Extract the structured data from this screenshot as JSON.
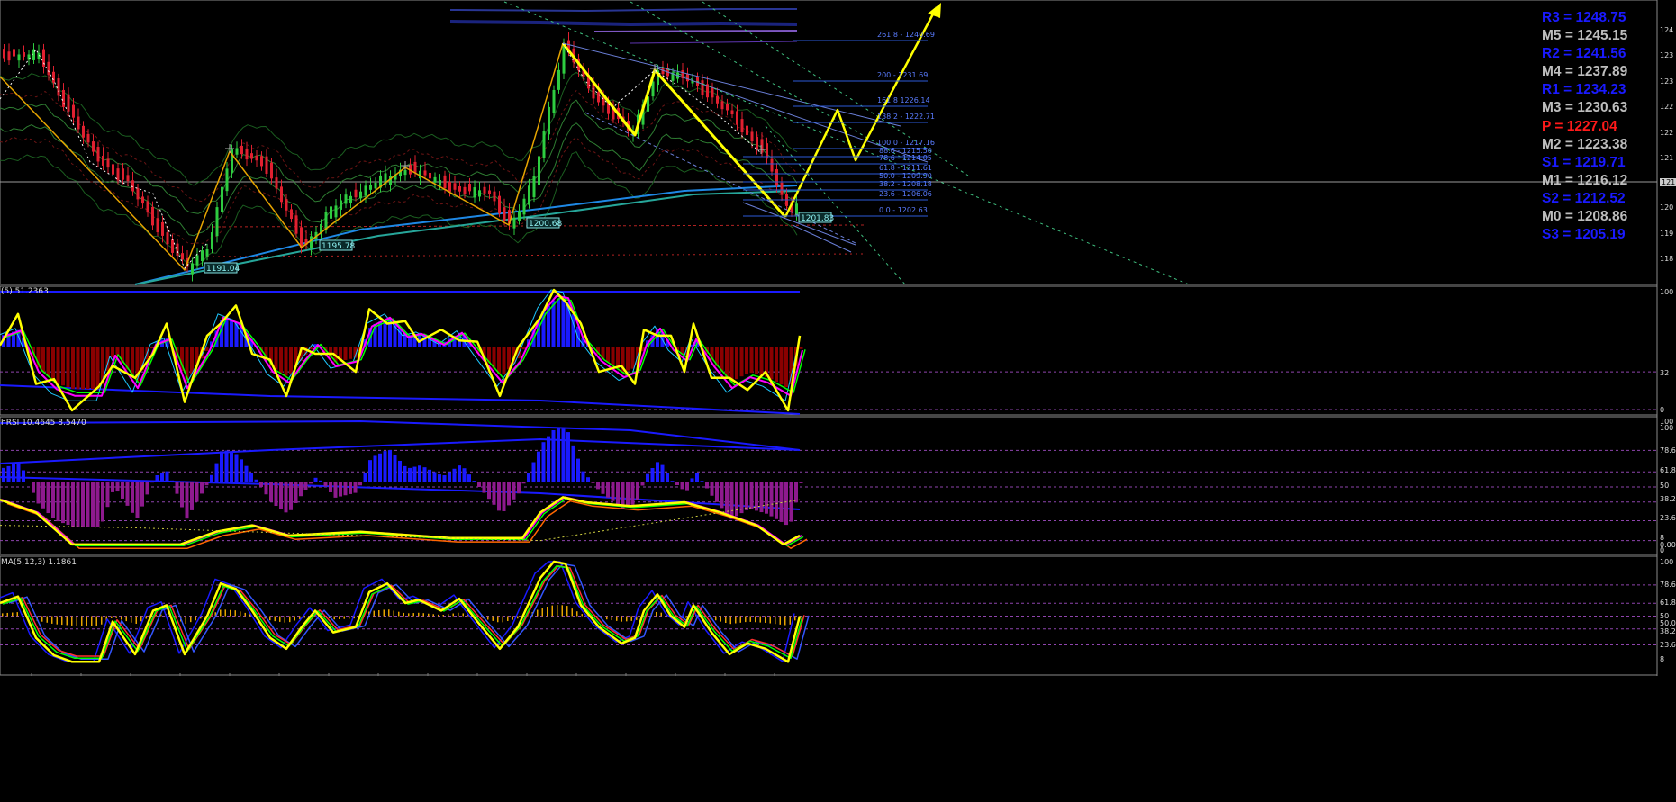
{
  "colors": {
    "background": "#000000",
    "candle_up": "#2ecc40",
    "candle_down": "#e02030",
    "zigzag": "#ffcc00",
    "projection": "#ffff00",
    "histogram_up": "#1a1aff",
    "histogram_down_1": "#8b0000",
    "histogram_down_2": "#8e1a8e",
    "fib_line": "#2b5ad8",
    "pivot_blue": "#1a1aff",
    "pivot_gray": "#bdbdbd",
    "pivot_red": "#ff1a1a"
  },
  "panes": [
    {
      "id": "price",
      "label": ""
    },
    {
      "id": "osc1",
      "label": "(5) 51.2363"
    },
    {
      "id": "osc2",
      "label": "hRSI 10.4645 8.5470"
    },
    {
      "id": "osc3",
      "label": "MA(5,12,3) 1.1861"
    }
  ],
  "price_axis_labels": [
    "124",
    "123",
    "123",
    "122",
    "122",
    "121",
    "121",
    "120",
    "119",
    "118"
  ],
  "current_price_tag": "121",
  "osc1_axis_labels": [
    "100",
    "32",
    "0"
  ],
  "osc2_axis_labels": [
    "100",
    "100",
    "78.6",
    "61.8",
    "50",
    "38.2",
    "23.6",
    "8",
    "0.00",
    "0"
  ],
  "osc3_axis_labels": [
    "100",
    "78.6",
    "61.8",
    "50",
    "50.00",
    "38.2",
    "23.6",
    "8"
  ],
  "pivots": [
    {
      "name": "R3",
      "value": "= 1248.75",
      "text": "R3 = 1248.75",
      "style": "blue"
    },
    {
      "name": "M5",
      "value": "= 1245.15",
      "text": "M5 = 1245.15",
      "style": "gray"
    },
    {
      "name": "R2",
      "value": "= 1241.56",
      "text": "R2 = 1241.56",
      "style": "blue"
    },
    {
      "name": "M4",
      "value": "= 1237.89",
      "text": "M4 = 1237.89",
      "style": "gray"
    },
    {
      "name": "R1",
      "value": "= 1234.23",
      "text": "R1 = 1234.23",
      "style": "blue"
    },
    {
      "name": "M3",
      "value": "= 1230.63",
      "text": "M3 = 1230.63",
      "style": "gray"
    },
    {
      "name": "P",
      "value": "= 1227.04",
      "text": "P  = 1227.04",
      "style": "red"
    },
    {
      "name": "M2",
      "value": "= 1223.38",
      "text": "M2 = 1223.38",
      "style": "gray"
    },
    {
      "name": "S1",
      "value": "= 1219.71",
      "text": "S1 = 1219.71",
      "style": "blue"
    },
    {
      "name": "M1",
      "value": "= 1216.12",
      "text": "M1 = 1216.12",
      "style": "gray"
    },
    {
      "name": "S2",
      "value": "= 1212.52",
      "text": "S2 = 1212.52",
      "style": "blue"
    },
    {
      "name": "M0",
      "value": "= 1208.86",
      "text": "M0 = 1208.86",
      "style": "gray"
    },
    {
      "name": "S3",
      "value": "= 1205.19",
      "text": "S3 = 1205.19",
      "style": "blue"
    }
  ],
  "chart_data": [
    {
      "type": "candlestick",
      "title": "",
      "price_labels": [
        {
          "text": "1191.04",
          "value": 1191.04
        },
        {
          "text": "1195.78",
          "value": 1195.78
        },
        {
          "text": "1200.68",
          "value": 1200.68
        },
        {
          "text": "1201.83",
          "value": 1201.83
        }
      ],
      "fibonacci_levels": [
        {
          "text": "261.8 - 1240.69",
          "ratio": 261.8,
          "value": 1240.69
        },
        {
          "text": "200 - 1231.69",
          "ratio": 200,
          "value": 1231.69
        },
        {
          "text": "161.8 1226.14",
          "ratio": 161.8,
          "value": 1226.14
        },
        {
          "text": "138.2 - 1222.71",
          "ratio": 138.2,
          "value": 1222.71
        },
        {
          "text": "100.0 - 1217.16",
          "ratio": 100.0,
          "value": 1217.16
        },
        {
          "text": "88.6 - 1215.50",
          "ratio": 88.6,
          "value": 1215.5
        },
        {
          "text": "78.6 - 1214.05",
          "ratio": 78.6,
          "value": 1214.05
        },
        {
          "text": "61.8 - 1211.61",
          "ratio": 61.8,
          "value": 1211.61
        },
        {
          "text": "50.0 - 1209.90",
          "ratio": 50.0,
          "value": 1209.9
        },
        {
          "text": "38.2 - 1208.18",
          "ratio": 38.2,
          "value": 1208.18
        },
        {
          "text": "23.6 - 1206.06",
          "ratio": 23.6,
          "value": 1206.06
        },
        {
          "text": "0.0 - 1202.63",
          "ratio": 0.0,
          "value": 1202.63
        }
      ]
    },
    {
      "type": "line",
      "title": "(5) 51.2363",
      "ylim": [
        0,
        100
      ],
      "levels": [
        0,
        32,
        100
      ]
    },
    {
      "type": "line",
      "title": "hRSI 10.4645 8.5470",
      "ylim": [
        0,
        100
      ],
      "levels": [
        8,
        23.6,
        38.2,
        50,
        61.8,
        78.6,
        100
      ]
    },
    {
      "type": "line",
      "title": "MA(5,12,3) 1.1861",
      "ylim": [
        0,
        100
      ],
      "levels": [
        8,
        23.6,
        38.2,
        50,
        61.8,
        78.6,
        100
      ]
    }
  ]
}
